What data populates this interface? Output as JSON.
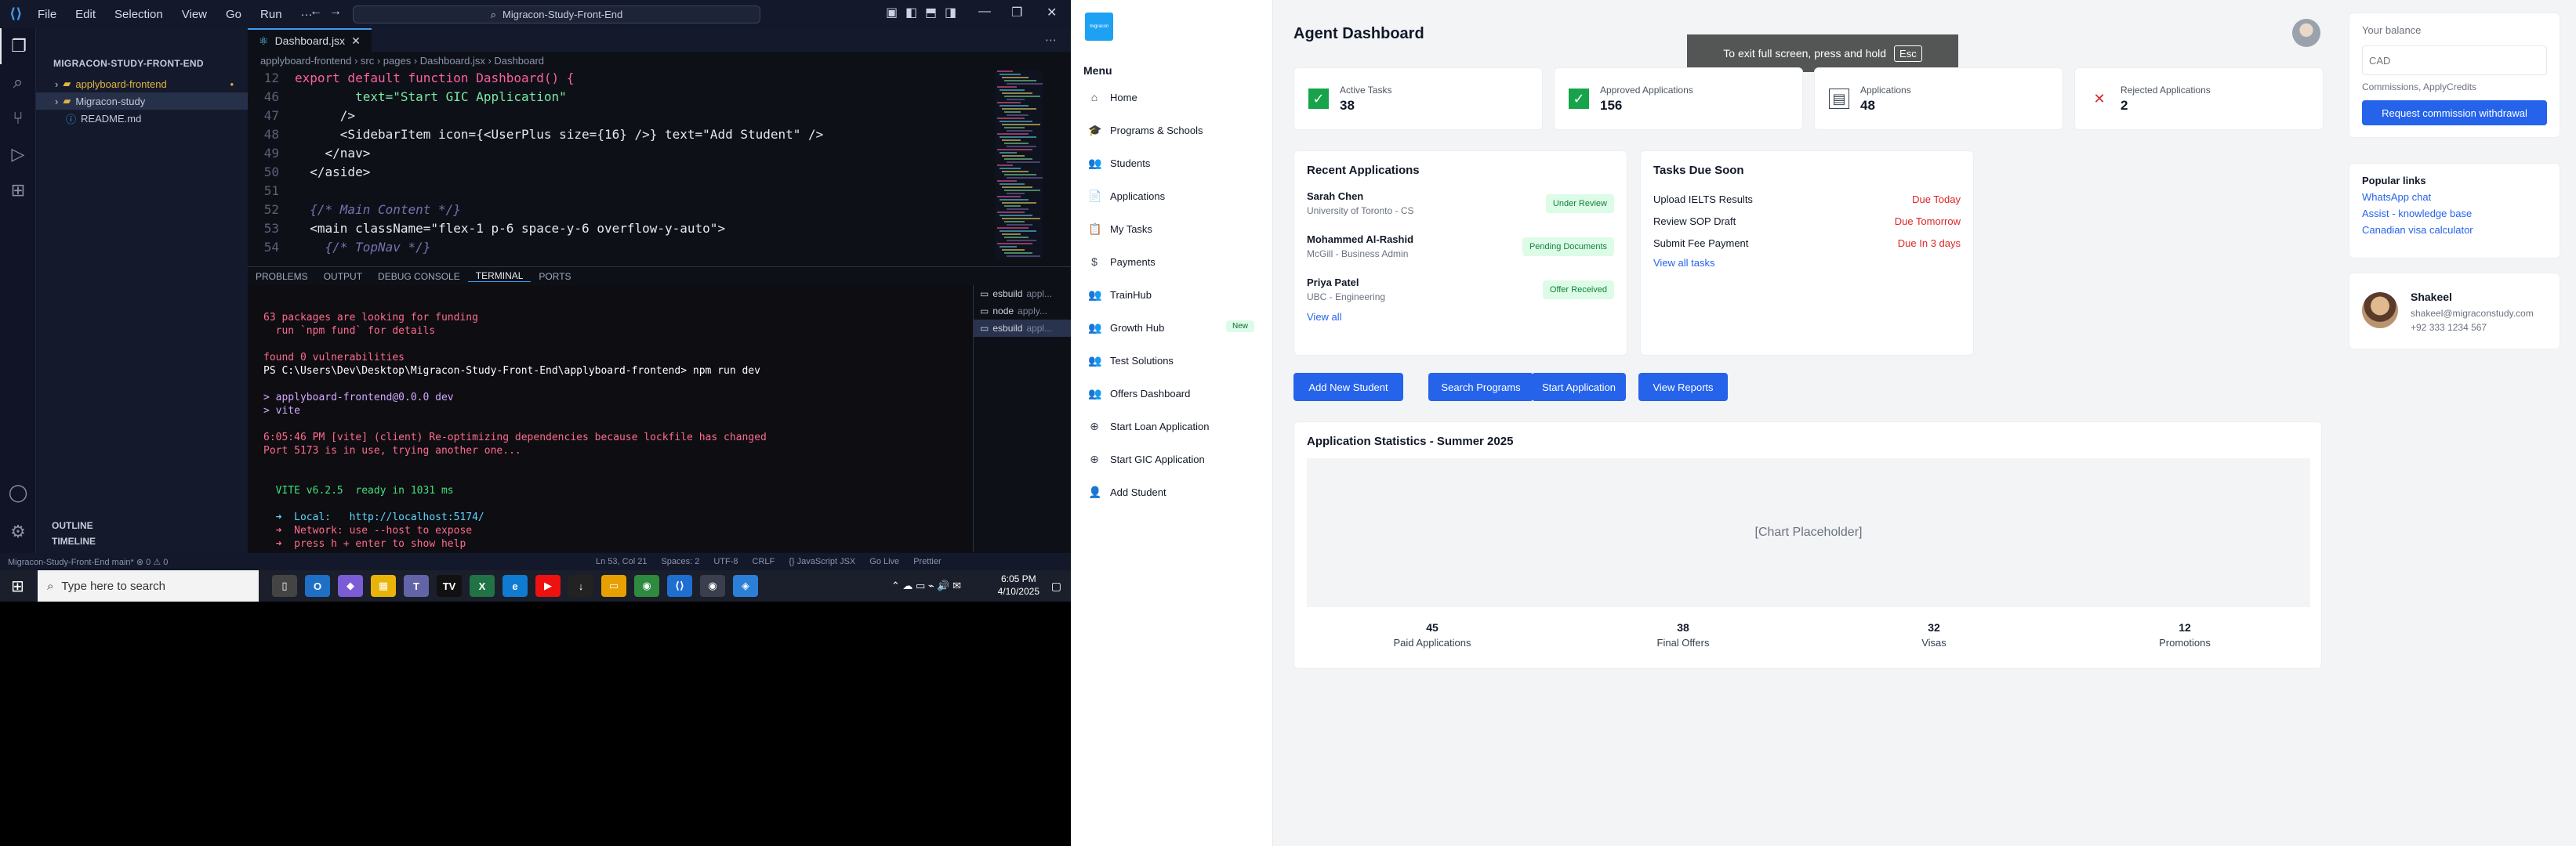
{
  "vscode": {
    "title_search": "Migracon-Study-Front-End",
    "menu": [
      "File",
      "Edit",
      "Selection",
      "View",
      "Go",
      "Run",
      "···"
    ],
    "explorer_title": "MIGRACON-STUDY-FRONT-END",
    "tree": [
      {
        "label": "applyboard-frontend",
        "type": "folder",
        "modified": "•"
      },
      {
        "label": "Migracon-study",
        "type": "folder"
      },
      {
        "label": "README.md",
        "type": "file"
      }
    ],
    "outline_label": "OUTLINE",
    "timeline_label": "TIMELINE",
    "tab_label": "Dashboard.jsx",
    "breadcrumb": "applyboard-frontend  ›  src  ›  pages  ›  Dashboard.jsx  ›  Dashboard",
    "code": [
      {
        "ln": "12",
        "text": "export default function Dashboard() {"
      },
      {
        "ln": "46",
        "text": "        text=\"Start GIC Application\""
      },
      {
        "ln": "47",
        "text": "      />"
      },
      {
        "ln": "48",
        "text": "      <SidebarItem icon={<UserPlus size={16} />} text=\"Add Student\" />"
      },
      {
        "ln": "49",
        "text": "    </nav>"
      },
      {
        "ln": "50",
        "text": "  </aside>"
      },
      {
        "ln": "51",
        "text": ""
      },
      {
        "ln": "52",
        "text": "  {/* Main Content */}"
      },
      {
        "ln": "53",
        "text": "  <main className=\"flex-1 p-6 space-y-6 overflow-y-auto\">"
      },
      {
        "ln": "54",
        "text": "    {/* TopNav */}"
      }
    ],
    "panel_tabs": [
      "PROBLEMS",
      "OUTPUT",
      "DEBUG CONSOLE",
      "TERMINAL",
      "PORTS"
    ],
    "terminal": [
      "63 packages are looking for funding",
      "  run `npm fund` for details",
      "",
      "found 0 vulnerabilities",
      "PS C:\\Users\\Dev\\Desktop\\Migracon-Study-Front-End\\applyboard-frontend> npm run dev",
      "",
      "> applyboard-frontend@0.0.0 dev",
      "> vite",
      "",
      "6:05:46 PM [vite] (client) Re-optimizing dependencies because lockfile has changed",
      "Port 5173 is in use, trying another one...",
      "",
      "",
      "  VITE v6.2.5  ready in 1031 ms",
      "",
      "  ➜  Local:   http://localhost:5174/",
      "  ➜  Network: use --host to expose",
      "  ➜  press h + enter to show help"
    ],
    "terminal_list": [
      {
        "label": "esbuild",
        "sub": "appl...",
        "active": false
      },
      {
        "label": "node",
        "sub": "apply...",
        "active": false
      },
      {
        "label": "esbuild",
        "sub": "appl...",
        "active": true
      }
    ],
    "status_left": "Migracon-Study-Front-End   main*   ⊗ 0 ⚠ 0",
    "status_right": [
      "Ln 53, Col 21",
      "Spaces: 2",
      "UTF-8",
      "CRLF",
      "{} JavaScript JSX",
      "Go Live",
      "Prettier"
    ]
  },
  "taskbar": {
    "search_placeholder": "Type here to search",
    "time": "6:05 PM",
    "date": "4/10/2025"
  },
  "app": {
    "brand": "migracon",
    "menu_title": "Menu",
    "nav": [
      {
        "label": "Home",
        "icon": "home-icon",
        "glyph": "⌂"
      },
      {
        "label": "Programs & Schools",
        "icon": "graduation-cap-icon",
        "glyph": "🎓"
      },
      {
        "label": "Students",
        "icon": "users-icon",
        "glyph": "👥"
      },
      {
        "label": "Applications",
        "icon": "file-icon",
        "glyph": "📄"
      },
      {
        "label": "My Tasks",
        "icon": "clipboard-icon",
        "glyph": "📋"
      },
      {
        "label": "Payments",
        "icon": "dollar-icon",
        "glyph": "$"
      },
      {
        "label": "TrainHub",
        "icon": "users-icon",
        "glyph": "👥"
      },
      {
        "label": "Growth Hub",
        "icon": "users-icon",
        "glyph": "👥",
        "badge": "New"
      },
      {
        "label": "Test Solutions",
        "icon": "users-icon",
        "glyph": "👥"
      },
      {
        "label": "Offers Dashboard",
        "icon": "users-icon",
        "glyph": "👥"
      },
      {
        "label": "Start Loan Application",
        "icon": "circle-arrow-icon",
        "glyph": "⊕"
      },
      {
        "label": "Start GIC Application",
        "icon": "circle-arrow-icon",
        "glyph": "⊕"
      },
      {
        "label": "Add Student",
        "icon": "user-plus-icon",
        "glyph": "👤"
      }
    ],
    "page_title": "Agent Dashboard",
    "fullscreen_toast": "To exit full screen, press and hold",
    "fullscreen_key": "Esc",
    "stats": [
      {
        "label": "Active Tasks",
        "value": "38",
        "icon": "check-box-icon"
      },
      {
        "label": "Approved Applications",
        "value": "156",
        "icon": "check-box-icon"
      },
      {
        "label": "Applications",
        "value": "48",
        "icon": "document-icon"
      },
      {
        "label": "Rejected Applications",
        "value": "2",
        "icon": "x-mark-icon"
      }
    ],
    "recent": {
      "title": "Recent Applications",
      "items": [
        {
          "name": "Sarah Chen",
          "school": "University of Toronto - CS",
          "status": "Under Review",
          "bg": "#dcfce7",
          "fg": "#15803d"
        },
        {
          "name": "Mohammed Al-Rashid",
          "school": "McGill - Business Admin",
          "status": "Pending Documents",
          "bg": "#dcfce7",
          "fg": "#15803d"
        },
        {
          "name": "Priya Patel",
          "school": "UBC - Engineering",
          "status": "Offer Received",
          "bg": "#dcfce7",
          "fg": "#15803d"
        }
      ],
      "view_all": "View all"
    },
    "tasks": {
      "title": "Tasks Due Soon",
      "items": [
        {
          "task": "Upload IELTS Results",
          "due": "Due Today"
        },
        {
          "task": "Review SOP Draft",
          "due": "Due Tomorrow"
        },
        {
          "task": "Submit Fee Payment",
          "due": "Due In 3 days"
        }
      ],
      "view_all": "View all tasks"
    },
    "actions": [
      "Add New Student",
      "Search Programs",
      "Start Application",
      "View Reports"
    ],
    "statistics": {
      "title": "Application Statistics - Summer 2025",
      "placeholder": "[Chart Placeholder]",
      "summary": [
        {
          "value": "45",
          "label": "Paid Applications"
        },
        {
          "value": "38",
          "label": "Final Offers"
        },
        {
          "value": "32",
          "label": "Visas"
        },
        {
          "value": "12",
          "label": "Promotions"
        }
      ]
    },
    "balance": {
      "label": "Your balance",
      "input_placeholder": "CAD",
      "note": "Commissions, ApplyCredits",
      "button": "Request commission withdrawal"
    },
    "popular": {
      "title": "Popular links",
      "links": [
        "WhatsApp chat",
        "Assist - knowledge base",
        "Canadian visa calculator"
      ]
    },
    "contact": {
      "name": "Shakeel",
      "email": "shakeel@migraconstudy.com",
      "phone": "+92 333 1234 567"
    }
  }
}
